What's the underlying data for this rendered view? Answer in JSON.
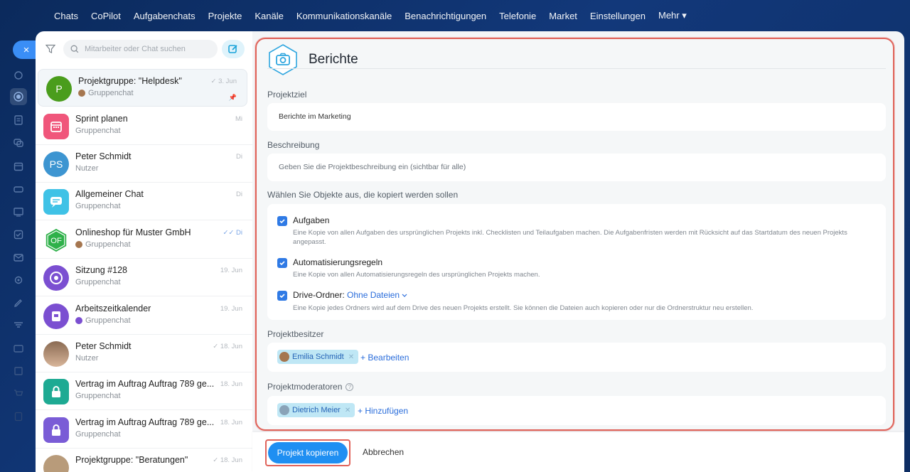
{
  "topnav": [
    "Chats",
    "CoPilot",
    "Aufgabenchats",
    "Projekte",
    "Kanäle",
    "Kommunikationskanäle",
    "Benachrichtigungen",
    "Telefonie",
    "Market",
    "Einstellungen",
    "Mehr ▾"
  ],
  "search": {
    "placeholder": "Mitarbeiter oder Chat suchen"
  },
  "chats": [
    {
      "name": "Projektgruppe: \"Helpdesk\"",
      "sub": "Gruppenchat",
      "date": "✓ 3. Jun",
      "avatar_text": "P",
      "color": "#4a9d1c",
      "pinned": "📌"
    },
    {
      "name": "Sprint planen",
      "sub": "Gruppenchat",
      "date": "Mi",
      "avatar_text": "",
      "color": "#f0567b"
    },
    {
      "name": "Peter Schmidt",
      "sub": "Nutzer",
      "date": "Di",
      "avatar_text": "PS",
      "color": "#3d95d1"
    },
    {
      "name": "Allgemeiner Chat",
      "sub": "Gruppenchat",
      "date": "Di",
      "avatar_text": "",
      "color": "#3fc2e6"
    },
    {
      "name": "Onlineshop für Muster GmbH",
      "sub": "Gruppenchat",
      "date": "✓✓ Di",
      "avatar_text": "OF",
      "color": "#2fb14a"
    },
    {
      "name": "Sitzung #128",
      "sub": "Gruppenchat",
      "date": "19. Jun",
      "avatar_text": "",
      "color": "#7b4fd1"
    },
    {
      "name": "Arbeitszeitkalender",
      "sub": "Gruppenchat",
      "date": "19. Jun",
      "avatar_text": "",
      "color": "#7b4fd1"
    },
    {
      "name": "Peter Schmidt",
      "sub": "Nutzer",
      "date": "✓ 18. Jun",
      "avatar_text": "",
      "color": "#c9a88a"
    },
    {
      "name": "Vertrag im Auftrag Auftrag 789 ge...",
      "sub": "Gruppenchat",
      "date": "18. Jun",
      "avatar_text": "",
      "color": "#1eaa93"
    },
    {
      "name": "Vertrag im Auftrag Auftrag 789 ge...",
      "sub": "Gruppenchat",
      "date": "18. Jun",
      "avatar_text": "",
      "color": "#7a5cd6"
    },
    {
      "name": "Projektgruppe: \"Beratungen\"",
      "sub": "",
      "date": "✓ 18. Jun",
      "avatar_text": "",
      "color": "#b89b7a"
    }
  ],
  "form": {
    "title": "Berichte",
    "goal_label": "Projektziel",
    "goal_value": "Berichte im Marketing",
    "desc_label": "Beschreibung",
    "desc_placeholder": "Geben Sie die Projektbeschreibung ein (sichtbar für alle)",
    "objects_label": "Wählen Sie Objekte aus, die kopiert werden sollen",
    "options": [
      {
        "title": "Aufgaben",
        "desc": "Eine Kopie von allen Aufgaben des ursprünglichen Projekts inkl. Checklisten und Teilaufgaben machen. Die Aufgabenfristen werden mit Rücksicht auf das Startdatum des neuen Projekts angepasst."
      },
      {
        "title": "Automatisierungsregeln",
        "desc": "Eine Kopie von allen Automatisierungsregeln des ursprünglichen Projekts machen."
      },
      {
        "title": "Drive-Ordner:",
        "link": "Ohne Dateien",
        "desc": "Eine Kopie jedes Ordners wird auf dem Drive des neuen Projekts erstellt. Sie können die Dateien auch kopieren oder nur die Ordnerstruktur neu erstellen."
      }
    ],
    "owner_label": "Projektbesitzer",
    "owner_tag": "Emilia Schmidt",
    "owner_action": "+ Bearbeiten",
    "moderators_label": "Projektmoderatoren",
    "moderator_tag": "Dietrich Meier",
    "moderator_action": "+ Hinzufügen"
  },
  "footer": {
    "primary": "Projekt kopieren",
    "cancel": "Abbrechen"
  },
  "close_icon": "×"
}
